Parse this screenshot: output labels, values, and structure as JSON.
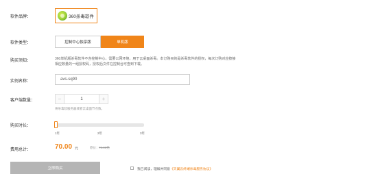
{
  "form": {
    "brand_label": "软件品牌：",
    "brand_name": "360杀毒软件",
    "type_label": "软件类型：",
    "type_options": [
      "控制中心独享版",
      "单机版"
    ],
    "notice_label": "购买须知：",
    "notice_text": "360单机版杀毒软件不含控制中心，需要公网环境，用于云桌面杀毒。本订购买的是杀毒软件的授权，每次订购对应按接相应数量的一组授权码，授权后文件在控制台可查到下载。",
    "instance_label": "实例名称：",
    "instance_value": "avs-sq90",
    "client_label": "客户端数量：",
    "client_minus": "−",
    "client_value": "1",
    "client_plus": "+",
    "client_hint": "将杀毒软服务器或者云桌面节点数。",
    "duration_label": "购买时长：",
    "duration_ticks": [
      "1年",
      "2年",
      "3年"
    ],
    "duration_selected_fraction": 0.0,
    "total_label": "费用总计：",
    "price": "70.00",
    "price_unit": "元",
    "orig_label": "原价：",
    "orig_price": "70.00元",
    "buy_button": "立即购买",
    "agree_prefix": "我已阅读，理解并同意",
    "agree_link": "《天翼云终端杀毒服务协议》"
  },
  "colors": {
    "accent": "#f08519",
    "disabled_button": "#b5b5b5"
  },
  "icons": {
    "brand": "360-logo-icon"
  }
}
